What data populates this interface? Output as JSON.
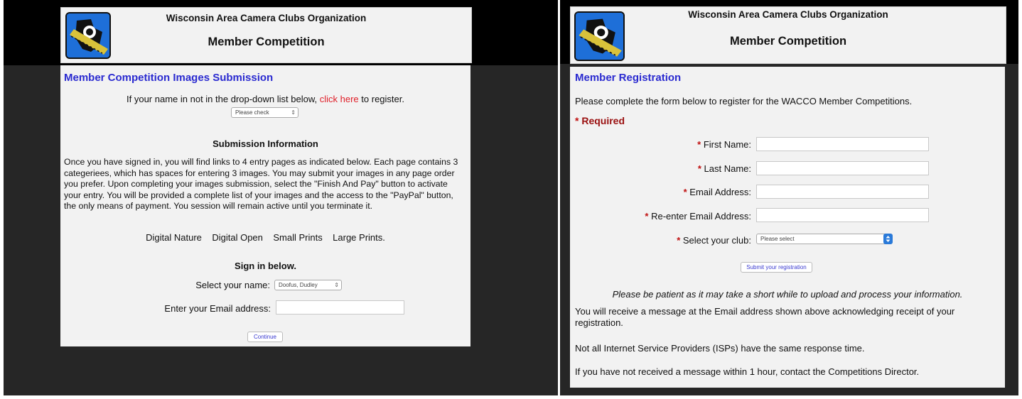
{
  "left": {
    "org_title": "Wisconsin Area Camera Clubs Organization",
    "comp_title": "Member Competition",
    "section_title": "Member Competition Images Submission",
    "register_prefix": "If your name in not in the drop-down list below,",
    "register_link": "click here",
    "register_suffix": "to register.",
    "name_dropdown": "Please check",
    "submission_heading": "Submission Information",
    "submission_paragraph": "Once you have signed in, you will find links to 4 entry pages as indicated below. Each page contains 3 categeriees, which has spaces for entering 3 images. You may submit your images in any page order you prefer. Upon completing your images submission, select the \"Finish And Pay\" button to activate your entry. You will be provided a complete list of your images and the access to the \"PayPal\" button, the only means of payment. You session will remain active until you terminate it.",
    "entry_pages": [
      "Digital Nature",
      "Digital Open",
      "Small Prints",
      "Large Prints."
    ],
    "signin_heading": "Sign in below.",
    "select_name_label": "Select your name:",
    "select_name_value": "Doofus, Dudley",
    "email_label": "Enter your Email address:",
    "email_value": "",
    "continue_button": "Continue"
  },
  "right": {
    "org_title": "Wisconsin Area Camera Clubs Organization",
    "comp_title": "Member Competition",
    "section_title": "Member Registration",
    "intro": "Please complete the form below to register for the WACCO Member Competitions.",
    "required_star": "*",
    "required_label": "Required",
    "fields": [
      {
        "label": "First Name:",
        "value": ""
      },
      {
        "label": "Last Name:",
        "value": ""
      },
      {
        "label": "Email Address:",
        "value": ""
      },
      {
        "label": "Re-enter Email Address:",
        "value": ""
      }
    ],
    "club_label": "Select your club:",
    "club_value": "Please select",
    "submit_button": "Submit your registration",
    "patience_note": "Please be patient as it may take a short while to upload and process your information.",
    "message_1": "You will receive a message at the Email address shown above acknowledging receipt of your registration.",
    "message_2": "Not all Internet Service Providers (ISPs) have the same response time.",
    "message_3": "If you have not received a message within 1 hour, contact the Competitions Director."
  },
  "colors": {
    "page_bg": "#262626",
    "header_bg": "#f2f2f2",
    "title_blue": "#2a2ad0",
    "link_red": "#e0202a",
    "required_red": "#c01010",
    "logo_blue": "#1e6fd8"
  }
}
